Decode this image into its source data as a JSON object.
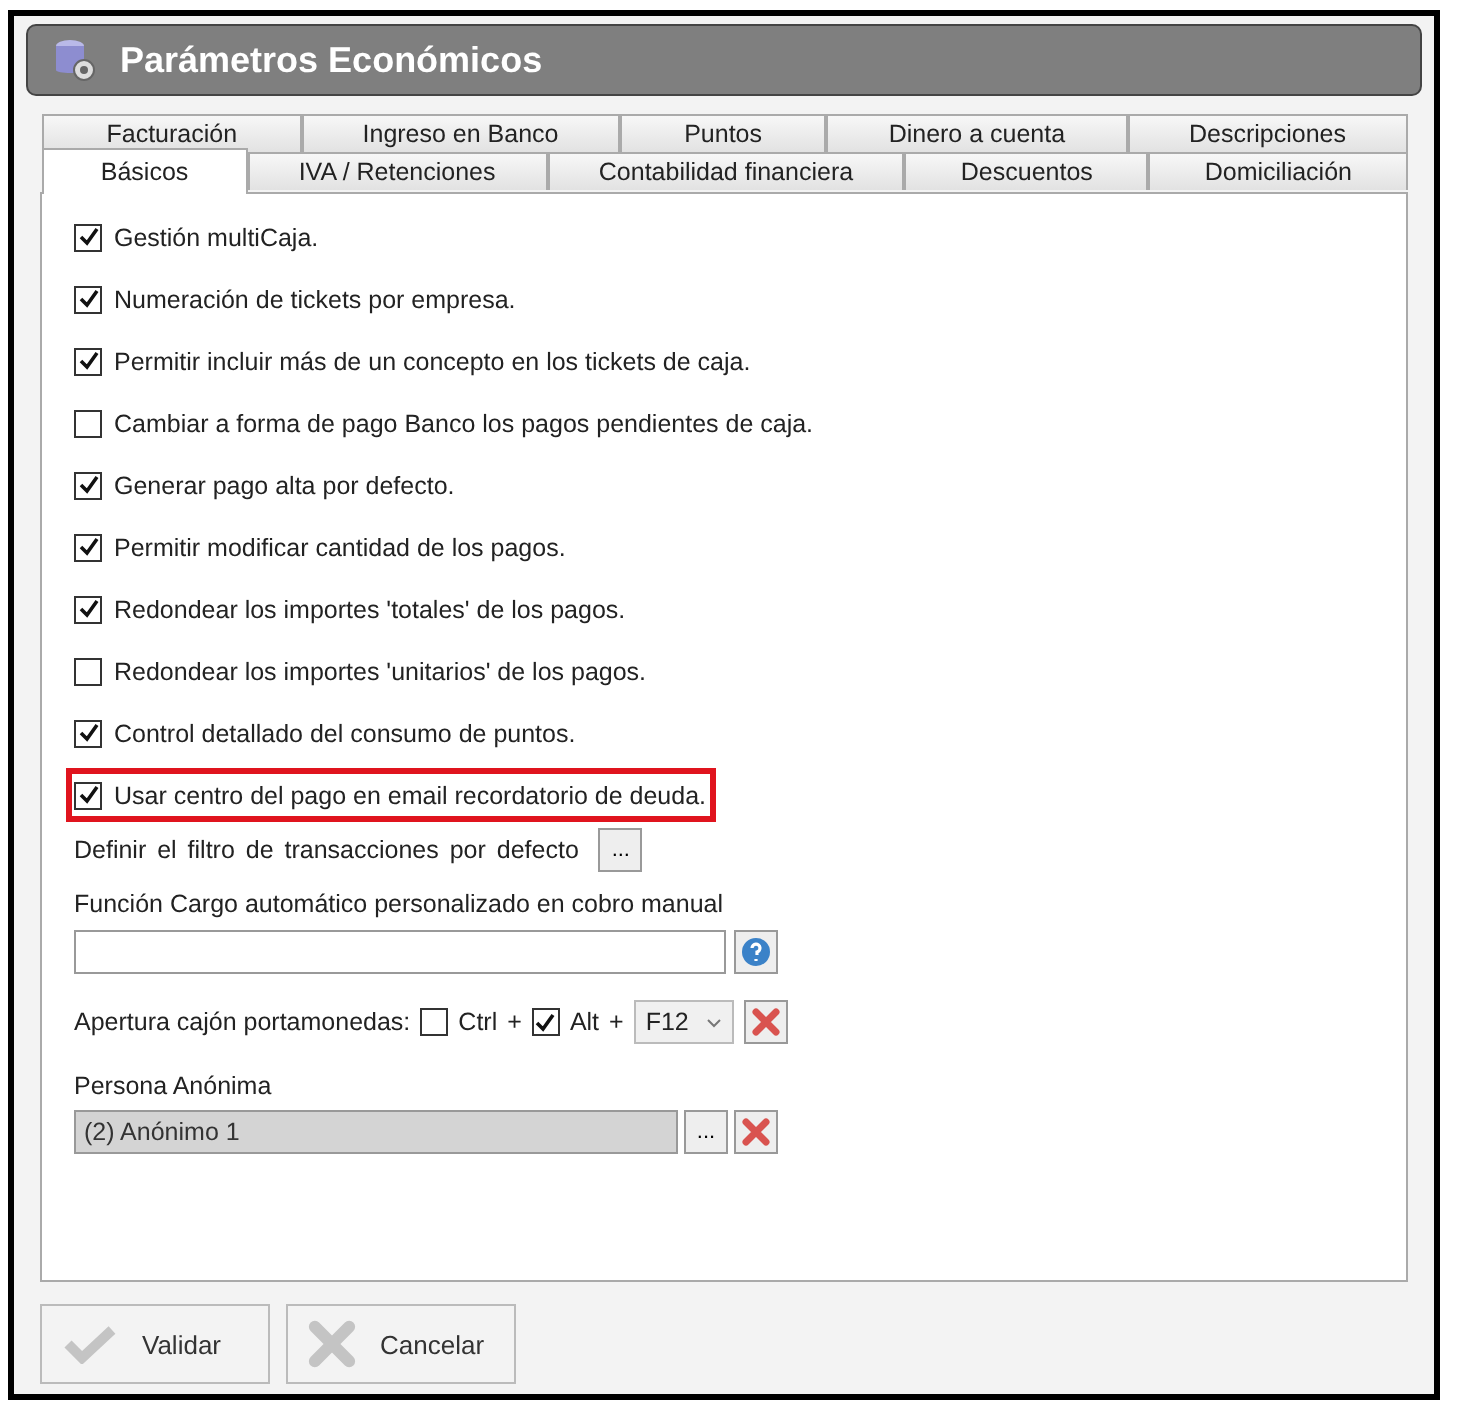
{
  "window": {
    "title": "Parámetros Económicos"
  },
  "tab_rows": [
    [
      {
        "label": "Facturación",
        "selected": false
      },
      {
        "label": "Ingreso en Banco",
        "selected": false
      },
      {
        "label": "Puntos",
        "selected": false
      },
      {
        "label": "Dinero a cuenta",
        "selected": false
      },
      {
        "label": "Descripciones",
        "selected": false
      }
    ],
    [
      {
        "label": "Básicos",
        "selected": true
      },
      {
        "label": "IVA / Retenciones",
        "selected": false
      },
      {
        "label": "Contabilidad financiera",
        "selected": false
      },
      {
        "label": "Descuentos",
        "selected": false
      },
      {
        "label": "Domiciliación",
        "selected": false
      }
    ]
  ],
  "options": [
    {
      "label": "Gestión multiCaja.",
      "checked": true,
      "highlighted": false
    },
    {
      "label": "Numeración de tickets por empresa.",
      "checked": true,
      "highlighted": false
    },
    {
      "label": "Permitir incluir más de un concepto en los tickets de caja.",
      "checked": true,
      "highlighted": false
    },
    {
      "label": "Cambiar a forma de pago Banco los pagos pendientes de caja.",
      "checked": false,
      "highlighted": false
    },
    {
      "label": "Generar pago alta por defecto.",
      "checked": true,
      "highlighted": false
    },
    {
      "label": "Permitir modificar cantidad de los pagos.",
      "checked": true,
      "highlighted": false
    },
    {
      "label": "Redondear los importes 'totales' de los pagos.",
      "checked": true,
      "highlighted": false
    },
    {
      "label": "Redondear los importes 'unitarios' de los pagos.",
      "checked": false,
      "highlighted": false
    },
    {
      "label": "Control detallado del consumo de puntos.",
      "checked": true,
      "highlighted": false
    },
    {
      "label": "Usar centro del pago en email recordatorio de deuda.",
      "checked": true,
      "highlighted": true
    }
  ],
  "filter": {
    "label": "Definir el filtro de transacciones por defecto",
    "button": "..."
  },
  "charge_function": {
    "label": "Función Cargo automático personalizado en cobro manual"
  },
  "drawer": {
    "label": "Apertura cajón portamonedas:",
    "modifiers": [
      {
        "label": "Ctrl",
        "checked": false,
        "plus": "+"
      },
      {
        "label": "Alt",
        "checked": true,
        "plus": "+"
      }
    ],
    "key": "F12"
  },
  "anonymous": {
    "label": "Persona Anónima",
    "value": "(2) Anónimo 1",
    "button": "..."
  },
  "buttons": [
    {
      "label": "Validar",
      "kind": "ok"
    },
    {
      "label": "Cancelar",
      "kind": "cancel"
    }
  ]
}
